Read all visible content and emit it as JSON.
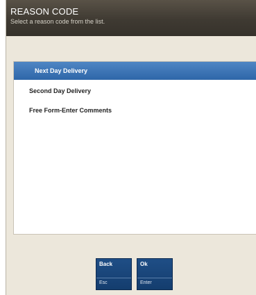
{
  "header": {
    "title": "REASON CODE",
    "subtitle": "Select a reason code from the list."
  },
  "reason_list": {
    "items": [
      {
        "label": "Next Day Delivery",
        "selected": true
      },
      {
        "label": "Second Day Delivery",
        "selected": false
      },
      {
        "label": "Free Form-Enter Comments",
        "selected": false
      }
    ]
  },
  "buttons": {
    "back": {
      "label": "Back",
      "key": "Esc"
    },
    "ok": {
      "label": "Ok",
      "key": "Enter"
    }
  },
  "colors": {
    "header_bg": "#3f3a32",
    "selected_bg": "#2e66a8",
    "button_bg": "#1a4679",
    "panel_bg": "#ece7db"
  }
}
